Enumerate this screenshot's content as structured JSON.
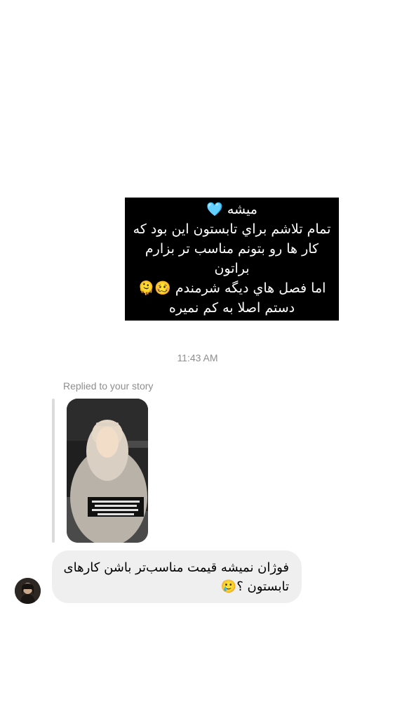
{
  "story_card": {
    "lines": [
      "میشه 🩵",
      "تمام تلاشم براي تابستون اين بود كه",
      "كار ها رو بتونم مناسب تر بزارم",
      "براتون",
      "اما فصل هاي ديگه شرمندم 🥴🫠",
      "دستم اصلا به كم نميره"
    ]
  },
  "timestamp": "11:43 AM",
  "reply": {
    "label": "Replied to your story"
  },
  "message": {
    "lines": [
      "فوژان نمیشه قیمت مناسب‌تر باشن کارهای",
      "تابستون ؟🥲"
    ]
  },
  "colors": {
    "background": "#ffffff",
    "bubble": "#efefef",
    "meta_text": "#8e8e8e",
    "story_card_bg": "#000000",
    "story_card_text": "#ffffff"
  }
}
